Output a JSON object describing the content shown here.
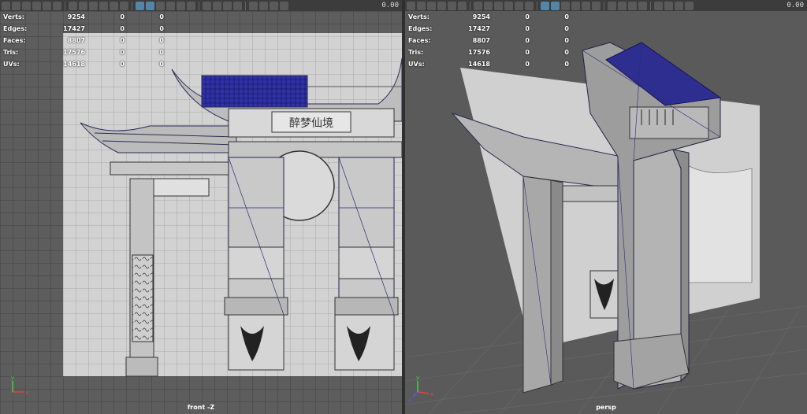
{
  "toolbar": {
    "time_value": "0.00"
  },
  "hud": {
    "rows": [
      {
        "label": "Verts:",
        "total": "9254",
        "selected": "0",
        "component": "0"
      },
      {
        "label": "Edges:",
        "total": "17427",
        "selected": "0",
        "component": "0"
      },
      {
        "label": "Faces:",
        "total": "8807",
        "selected": "0",
        "component": "0"
      },
      {
        "label": "Tris:",
        "total": "17576",
        "selected": "0",
        "component": "0"
      },
      {
        "label": "UVs:",
        "total": "14618",
        "selected": "0",
        "component": "0"
      }
    ]
  },
  "viewports": {
    "left": {
      "label": "front -Z"
    },
    "right": {
      "label": "persp"
    }
  },
  "scene": {
    "signboard_text": "醉梦仙境",
    "axis_labels": {
      "x": "x",
      "y": "y",
      "z": "z"
    }
  },
  "colors": {
    "grid": "#3a3a3a",
    "wire": "#2a2a7a",
    "roof_selected": "#2a2aa0",
    "toolbar_active": "#5285a6"
  }
}
